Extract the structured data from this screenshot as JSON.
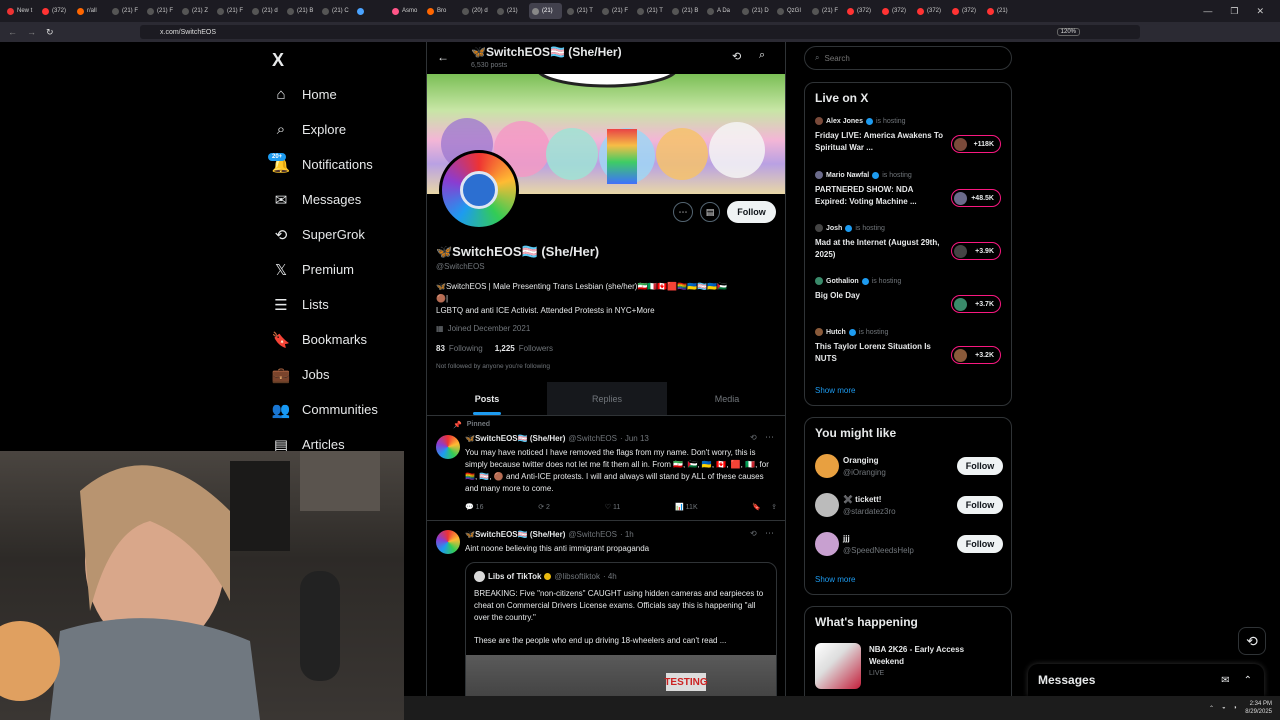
{
  "browser": {
    "tabs": [
      "New t",
      "(372)",
      "r/all",
      "(21) F",
      "(21) F",
      "(21) Z",
      "(21) F",
      "(21) d",
      "(21) B",
      "(21) C",
      "",
      "Asmo",
      "Bro",
      "(20) d",
      "(21)",
      "(21)",
      "(21) T",
      "(21) F",
      "(21) T",
      "(21) B",
      "A Da",
      "(21) D",
      "QzGI",
      "(21) F",
      "(372)",
      "(372)",
      "(372)",
      "(372)",
      "(21)"
    ],
    "url": "x.com/SwitchEOS",
    "zoom": "120%"
  },
  "nav": {
    "logo": "X",
    "notif_badge": "20+",
    "items": [
      {
        "label": "Home",
        "icon": "home-icon"
      },
      {
        "label": "Explore",
        "icon": "search-icon"
      },
      {
        "label": "Notifications",
        "icon": "bell-icon"
      },
      {
        "label": "Messages",
        "icon": "mail-icon"
      },
      {
        "label": "SuperGrok",
        "icon": "grok-icon"
      },
      {
        "label": "Premium",
        "icon": "x-icon"
      },
      {
        "label": "Lists",
        "icon": "list-icon"
      },
      {
        "label": "Bookmarks",
        "icon": "bookmark-icon"
      },
      {
        "label": "Jobs",
        "icon": "briefcase-icon"
      },
      {
        "label": "Communities",
        "icon": "people-icon"
      },
      {
        "label": "Articles",
        "icon": "article-icon"
      }
    ]
  },
  "profile": {
    "header_name": "🦋SwitchEOS🏳️‍⚧️ (She/Her)",
    "post_count": "6,530 posts",
    "name": "🦋SwitchEOS🏳️‍⚧️ (She/Her)",
    "handle": "@SwitchEOS",
    "bio_line1": "🦋SwitchEOS | Male Presenting Trans Lesbian (she/her)🇮🇷🇮🇹🇨🇦🟥🏳️‍🌈🇺🇦🏳️‍⚧️🇺🇦🇵🇸",
    "bio_line2": "🟤|",
    "bio_line3": "LGBTQ and anti ICE Activist. Attended Protests in NYC+More",
    "joined": "Joined December 2021",
    "following_count": "83",
    "following_label": "Following",
    "followers_count": "1,225",
    "followers_label": "Followers",
    "followed_note": "Not followed by anyone you're following",
    "follow_label": "Follow",
    "tabs": [
      "Posts",
      "Replies",
      "Media"
    ]
  },
  "posts": [
    {
      "pinned": "Pinned",
      "name": "🦋SwitchEOS🏳️‍⚧️ (She/Her)",
      "handle": "@SwitchEOS",
      "time": "· Jun 13",
      "text": "You may have noticed I have removed the flags from my name. Don't worry, this is simply because twitter does not let me fit them all in. From 🇮🇷, 🇵🇸, 🇺🇦, 🇨🇦, 🟥, 🇮🇹, for 🏳️‍🌈, 🏳️‍⚧️, 🟤 and Anti-ICE protests. I will and always will stand by ALL of these causes and many more to come.",
      "replies": "16",
      "reposts": "2",
      "likes": "11",
      "views": "11K"
    },
    {
      "name": "🦋SwitchEOS🏳️‍⚧️ (She/Her)",
      "handle": "@SwitchEOS",
      "time": "· 1h",
      "text": "Aint noone believing this anti immigrant propaganda",
      "quote_name": "Libs of TikTok",
      "quote_handle": "@libsoftiktok",
      "quote_time": "· 4h",
      "quote_text": "BREAKING: Five \"non-citizens\" CAUGHT using hidden cameras and earpieces to cheat on Commercial Drivers License exams. Officials say this is happening \"all over the country.\"",
      "quote_text2": "These are the people who end up driving 18-wheelers and can't read ...",
      "media_text": "TESTING"
    }
  ],
  "search": {
    "placeholder": "Search"
  },
  "live": {
    "title": "Live on X",
    "hosting": "is hosting",
    "items": [
      {
        "host": "Alex Jones",
        "title": "Friday LIVE: America Awakens To Spiritual War ...",
        "count": "+118K"
      },
      {
        "host": "Mario Nawfal",
        "title": "PARTNERED SHOW: NDA Expired: Voting Machine ...",
        "count": "+48.5K"
      },
      {
        "host": "Josh",
        "title": "Mad at the Internet (August 29th, 2025)",
        "count": "+3.9K"
      },
      {
        "host": "Gothalion",
        "title": "Big Ole Day",
        "count": "+3.7K"
      },
      {
        "host": "Hutch",
        "title": "This Taylor Lorenz Situation Is NUTS",
        "count": "+3.2K"
      }
    ],
    "show_more": "Show more"
  },
  "suggest": {
    "title": "You might like",
    "items": [
      {
        "name": "Oranging",
        "handle": "@iOranging"
      },
      {
        "name": "✖️ tickett!",
        "handle": "@stardatez3ro"
      },
      {
        "name": "jjj",
        "handle": "@SpeedNeedsHelp"
      }
    ],
    "follow_label": "Follow",
    "show_more": "Show more"
  },
  "happening": {
    "title": "What's happening",
    "item_title": "NBA 2K26 - Early Access Weekend",
    "item_sub": "LIVE"
  },
  "messages_drawer": {
    "title": "Messages"
  },
  "taskbar": {
    "time": "2:34 PM",
    "date": "8/29/2025"
  },
  "colors": {
    "accent": "#1d9bf0",
    "live": "#f91880",
    "bg": "#000000",
    "border": "#2f3336"
  }
}
